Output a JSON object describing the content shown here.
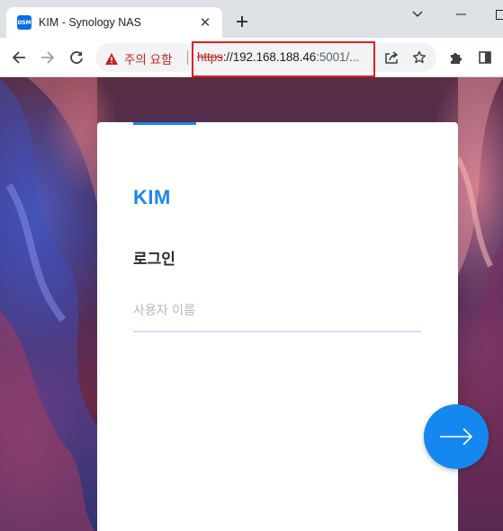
{
  "tab": {
    "favicon_text": "DSM",
    "title": "KIM - Synology NAS",
    "close_glyph": "✕",
    "new_tab_glyph": "+"
  },
  "toolbar": {
    "security_warning": "주의 요함",
    "url_scheme": "https",
    "url_host": "://192.168.188.46",
    "url_rest": ":5001/..."
  },
  "login": {
    "brand": "KIM",
    "heading": "로그인",
    "username_placeholder": "사용자 이름",
    "username_value": ""
  },
  "icons": {
    "back": "arrow-left-icon",
    "forward": "arrow-right-icon",
    "reload": "reload-icon",
    "warning": "warning-triangle-icon",
    "share": "share-icon",
    "bookmark": "star-icon",
    "extensions": "puzzle-icon",
    "side_panel": "side-panel-icon",
    "next": "arrow-right-icon"
  },
  "colors": {
    "accent": "#1d86ec",
    "warning": "#c5221f",
    "highlight": "#e31e24"
  }
}
